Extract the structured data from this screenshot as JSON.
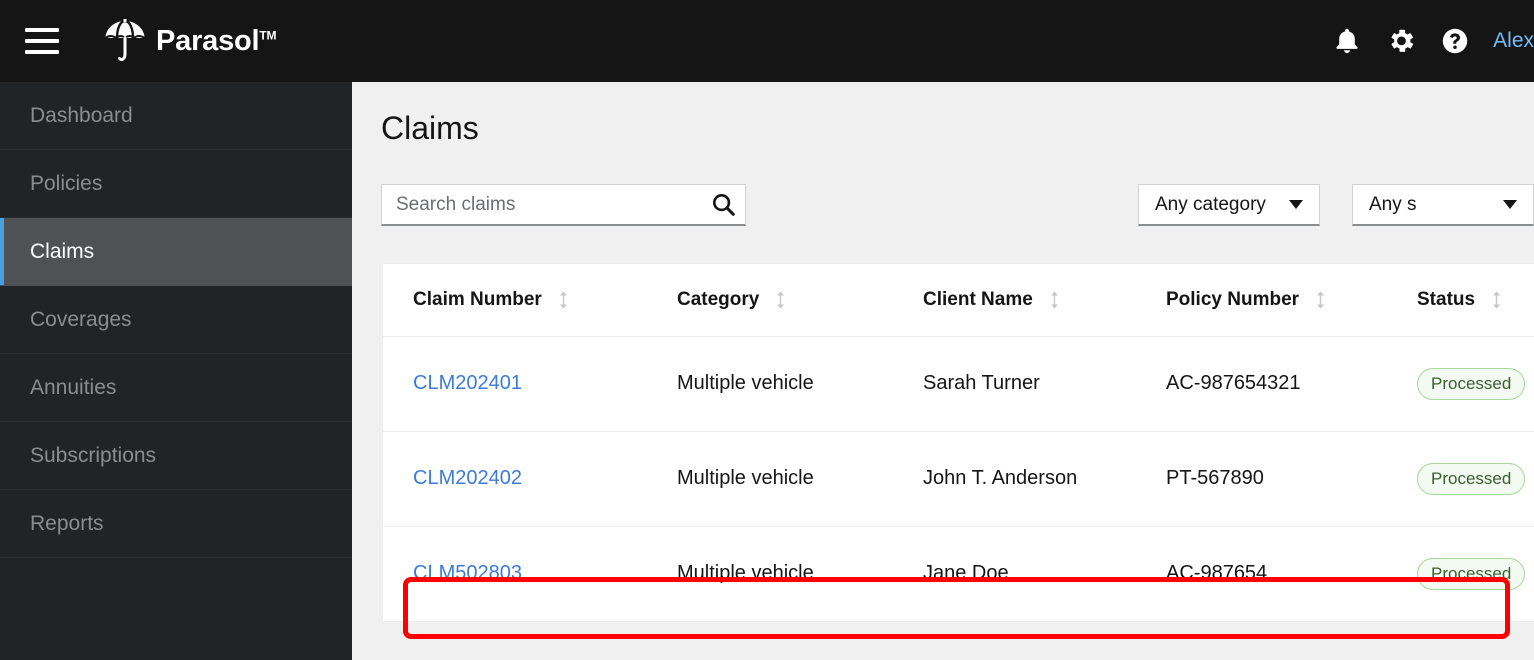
{
  "masthead": {
    "menu_icon": "hamburger-icon",
    "brand_name": "Parasol",
    "brand_tm": "TM",
    "logo_icon": "umbrella-icon",
    "notifications_icon": "bell-icon",
    "settings_icon": "gear-icon",
    "help_icon": "question-circle-icon",
    "user_name": "Alex"
  },
  "sidebar": {
    "items": [
      {
        "label": "Dashboard",
        "active": false
      },
      {
        "label": "Policies",
        "active": false
      },
      {
        "label": "Claims",
        "active": true
      },
      {
        "label": "Coverages",
        "active": false
      },
      {
        "label": "Annuities",
        "active": false
      },
      {
        "label": "Subscriptions",
        "active": false
      },
      {
        "label": "Reports",
        "active": false
      }
    ],
    "accent_color": "#4a9fe0"
  },
  "main": {
    "page_title": "Claims",
    "search": {
      "placeholder": "Search claims",
      "value": "",
      "icon": "search-icon"
    },
    "filters": [
      {
        "label": "Any category",
        "icon": "chevron-down-icon"
      },
      {
        "label": "Any s",
        "icon": "chevron-down-icon"
      }
    ],
    "table": {
      "columns": [
        {
          "label": "Claim Number",
          "sort_icon": "sort-arrows-icon"
        },
        {
          "label": "Category",
          "sort_icon": "sort-arrows-icon"
        },
        {
          "label": "Client Name",
          "sort_icon": "sort-arrows-icon"
        },
        {
          "label": "Policy Number",
          "sort_icon": "sort-arrows-icon"
        },
        {
          "label": "Status",
          "sort_icon": "sort-arrows-icon"
        }
      ],
      "rows": [
        {
          "claim_number": "CLM202401",
          "category": "Multiple vehicle",
          "client_name": "Sarah Turner",
          "policy_number": "AC-987654321",
          "status": "Processed",
          "highlighted": false
        },
        {
          "claim_number": "CLM202402",
          "category": "Multiple vehicle",
          "client_name": "John T. Anderson",
          "policy_number": "PT-567890",
          "status": "Processed",
          "highlighted": false
        },
        {
          "claim_number": "CLM502803",
          "category": "Multiple vehicle",
          "client_name": "Jane Doe",
          "policy_number": "AC-987654",
          "status": "Processed",
          "highlighted": true
        }
      ]
    }
  },
  "annotation": {
    "color": "#ff0000",
    "target": "CLM502803"
  },
  "colors": {
    "masthead_bg": "#151515",
    "sidebar_bg": "#212427",
    "sidebar_active_bg": "#4f5255",
    "page_bg": "#f0f0f0",
    "link": "#3d7bd9",
    "badge_border": "#a7d79b",
    "badge_bg": "#f3faf1",
    "badge_text": "#3d5c34"
  }
}
